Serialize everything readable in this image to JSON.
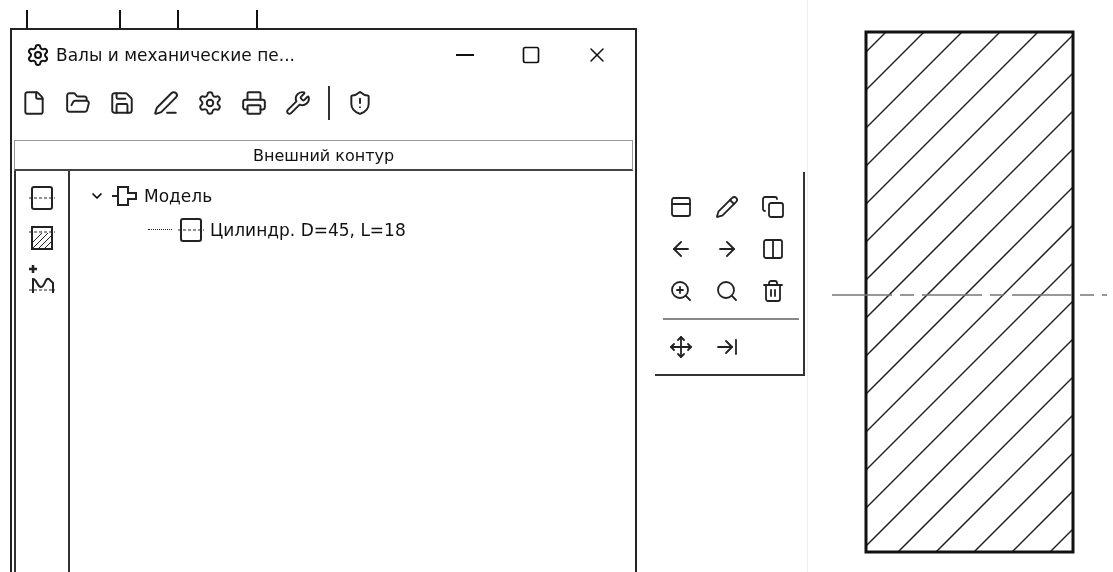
{
  "window": {
    "title": "Валы и механические пе..."
  },
  "section_header": "Внешний контур",
  "tree": [
    {
      "label": "Модель",
      "expanded": true,
      "children": [
        {
          "label": "Цилиндр. D=45, L=18"
        }
      ]
    }
  ]
}
